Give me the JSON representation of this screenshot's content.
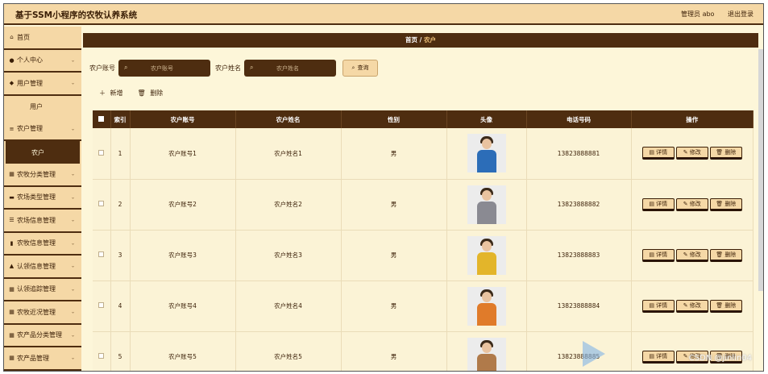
{
  "app": {
    "title": "基于SSM小程序的农牧认养系统",
    "admin_label": "管理员 abo",
    "logout_label": "退出登录"
  },
  "sidebar": {
    "items": [
      {
        "label": "首页",
        "icon": "home-icon",
        "glyph": "⌂",
        "chevron": false
      },
      {
        "label": "个人中心",
        "icon": "user-icon",
        "glyph": "●",
        "chevron": true
      },
      {
        "label": "用户管理",
        "icon": "pin-icon",
        "glyph": "◆",
        "chevron": true
      },
      {
        "label": "用户",
        "sub": true
      },
      {
        "label": "农户管理",
        "icon": "list-icon",
        "glyph": "≡",
        "chevron": true
      },
      {
        "label": "农户",
        "sub": true,
        "active": true
      },
      {
        "label": "农牧分类管理",
        "icon": "grid-icon",
        "glyph": "▦",
        "chevron": true
      },
      {
        "label": "农场类型管理",
        "icon": "folder-icon",
        "glyph": "▬",
        "chevron": true
      },
      {
        "label": "农场信息管理",
        "icon": "sliders-icon",
        "glyph": "☰",
        "chevron": true
      },
      {
        "label": "农牧信息管理",
        "icon": "book-icon",
        "glyph": "▮",
        "chevron": true
      },
      {
        "label": "认领信息管理",
        "icon": "home-icon",
        "glyph": "▲",
        "chevron": true
      },
      {
        "label": "认领追踪管理",
        "icon": "grid-icon",
        "glyph": "▦",
        "chevron": true
      },
      {
        "label": "农牧近况管理",
        "icon": "grid-icon",
        "glyph": "▦",
        "chevron": true
      },
      {
        "label": "农产品分类管理",
        "icon": "grid-icon",
        "glyph": "▦",
        "chevron": true
      },
      {
        "label": "农产品管理",
        "icon": "grid-icon",
        "glyph": "▦",
        "chevron": true
      }
    ]
  },
  "breadcrumb": {
    "home": "首页",
    "sep": "/",
    "current": "农户"
  },
  "search": {
    "account_label": "农户账号",
    "account_placeholder": "农户账号",
    "name_label": "农户姓名",
    "name_placeholder": "农户姓名",
    "query_label": "查询"
  },
  "toolbar": {
    "add_label": "新增",
    "delete_label": "删除"
  },
  "table": {
    "headers": [
      "索引",
      "农户账号",
      "农户姓名",
      "性别",
      "头像",
      "电话号码",
      "操作"
    ],
    "rows": [
      {
        "index": "1",
        "account": "农户账号1",
        "name": "农户姓名1",
        "gender": "男",
        "phone": "13823888881"
      },
      {
        "index": "2",
        "account": "农户账号2",
        "name": "农户姓名2",
        "gender": "男",
        "phone": "13823888882"
      },
      {
        "index": "3",
        "account": "农户账号3",
        "name": "农户姓名3",
        "gender": "男",
        "phone": "13823888883"
      },
      {
        "index": "4",
        "account": "农户账号4",
        "name": "农户姓名4",
        "gender": "男",
        "phone": "13823888884"
      },
      {
        "index": "5",
        "account": "农户账号5",
        "name": "农户姓名5",
        "gender": "男",
        "phone": "13823888885"
      }
    ],
    "detail_label": "详情",
    "edit_label": "修改",
    "delete_label": "删除"
  },
  "watermark": "CSDN @jinlin04"
}
